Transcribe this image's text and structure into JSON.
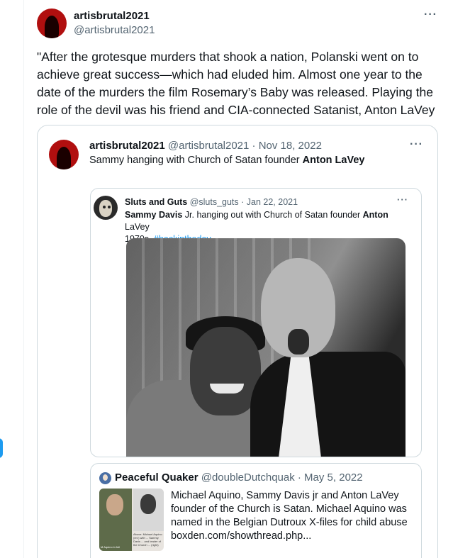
{
  "tweet": {
    "name": "artisbrutal2021",
    "handle": "@artisbrutal2021",
    "more": "···",
    "text": "\"After the grotesque murders that shook a nation, Polanski went on to achieve great success—which had eluded him. Almost one year to the date of the murders the film Rosemary’s Baby was released. Playing the role of the devil was his friend and CIA-connected Satanist, Anton LaVey"
  },
  "quote1": {
    "name": "artisbrutal2021",
    "meta": "@artisbrutal2021 · Nov 18, 2022",
    "more": "···",
    "text_prefix": "Sammy hanging with Church of Satan founder ",
    "text_bold": "Anton LaVey"
  },
  "quote2": {
    "name": "Sluts and Guts",
    "meta": "@sluts_guts · Jan 22, 2021",
    "more": "···",
    "text_b1": "Sammy Davis",
    "text_1": " Jr. hanging out with Church of Satan founder ",
    "text_b2": "Anton",
    "text_2": " LaVey",
    "text_3": "1970s. ",
    "hashtag": "#backintheday"
  },
  "quote3": {
    "name": "Peaceful Quaker",
    "meta": "@doubleDutchquak · May 5, 2022",
    "text": "Michael Aquino, Sammy Davis jr and Anton LaVey founder of the Church is Satan. Michael Aquino was named in the Belgian Dutroux X-files for child abuse boxden.com/showthread.php...",
    "thumb_caption": "Above: Michael Aquino (ret.) with ... Sammy Davis ... and leader of the Church ... (right)",
    "thumb_caption_left": "M Aquino in full"
  },
  "colors": {
    "accent": "#1d9bf0",
    "secondary_text": "#536471",
    "border": "#cfd9de"
  }
}
